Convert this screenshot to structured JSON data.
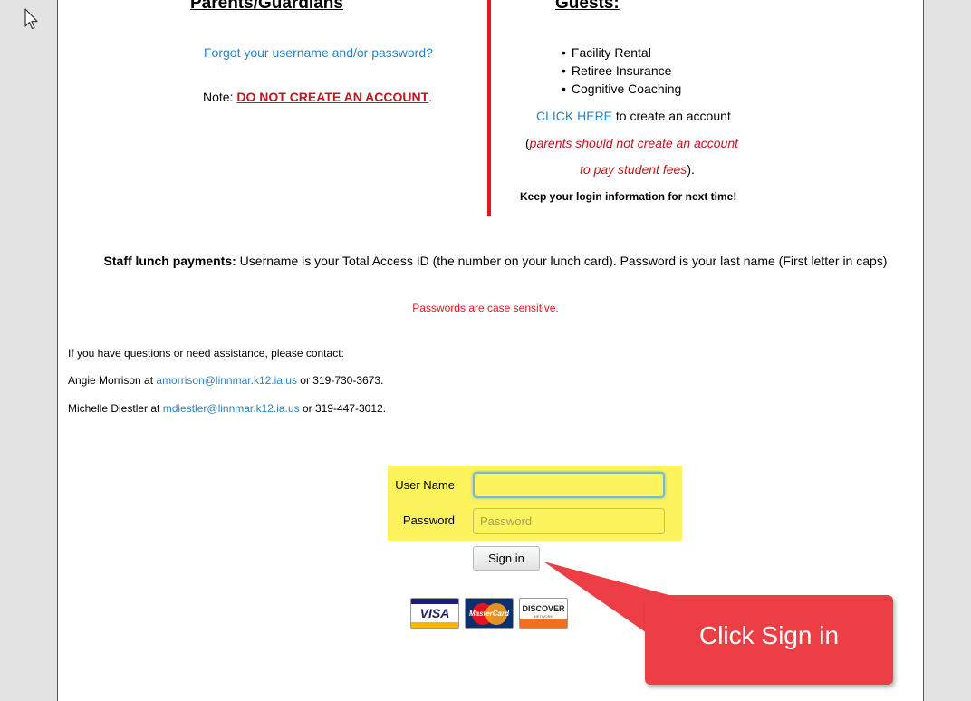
{
  "parents": {
    "heading": "Parents/Guardians",
    "forgot_link": "Forgot your username and/or password?",
    "note_prefix": "Note: ",
    "note_warning": "DO NOT CREATE AN ACCOUNT",
    "note_suffix": "."
  },
  "guests": {
    "heading": "Guests:",
    "items": [
      "Facility Rental",
      "Retiree Insurance",
      "Cognitive Coaching"
    ],
    "click_here": "CLICK HERE",
    "create_suffix": " to create an account",
    "paren_open": "(",
    "parents_note_1": "parents should not create an account",
    "parents_note_2": "to pay student fees",
    "paren_close": ").",
    "keep_login": "Keep your login information for next time!"
  },
  "staff": {
    "label": "Staff lunch payments:",
    "text": " Username is your Total Access ID (the number on your lunch card). Password is your last name (First letter in caps)",
    "case_sensitive": "Passwords are case sensitive."
  },
  "contact": {
    "intro": "If you have questions or need assistance, please contact:",
    "people": [
      {
        "prefix": "Angie Morrison at ",
        "email": "amorrison@linnmar.k12.ia.us",
        "suffix": " or 319-730-3673."
      },
      {
        "prefix": "Michelle Diestler at ",
        "email": "mdiestler@linnmar.k12.ia.us",
        "suffix": " or 319-447-3012."
      }
    ]
  },
  "login": {
    "username_label": "User Name",
    "username_value": "",
    "password_label": "Password",
    "password_placeholder": "Password",
    "signin_label": "Sign in"
  },
  "cards": {
    "visa": "VISA",
    "mastercard": "MasterCard",
    "discover": "DISCOVER",
    "discover_sub": "NETWORK"
  },
  "callout": {
    "text": "Click Sign in"
  },
  "colors": {
    "link": "#2f83c4",
    "warning_red": "#c0161d",
    "divider_red": "#e8151f",
    "login_highlight": "#fdf35d",
    "callout": "#ee3e45"
  },
  "icons": [
    "mouse-cursor-icon",
    "visa-card-icon",
    "mastercard-icon",
    "discover-card-icon"
  ]
}
